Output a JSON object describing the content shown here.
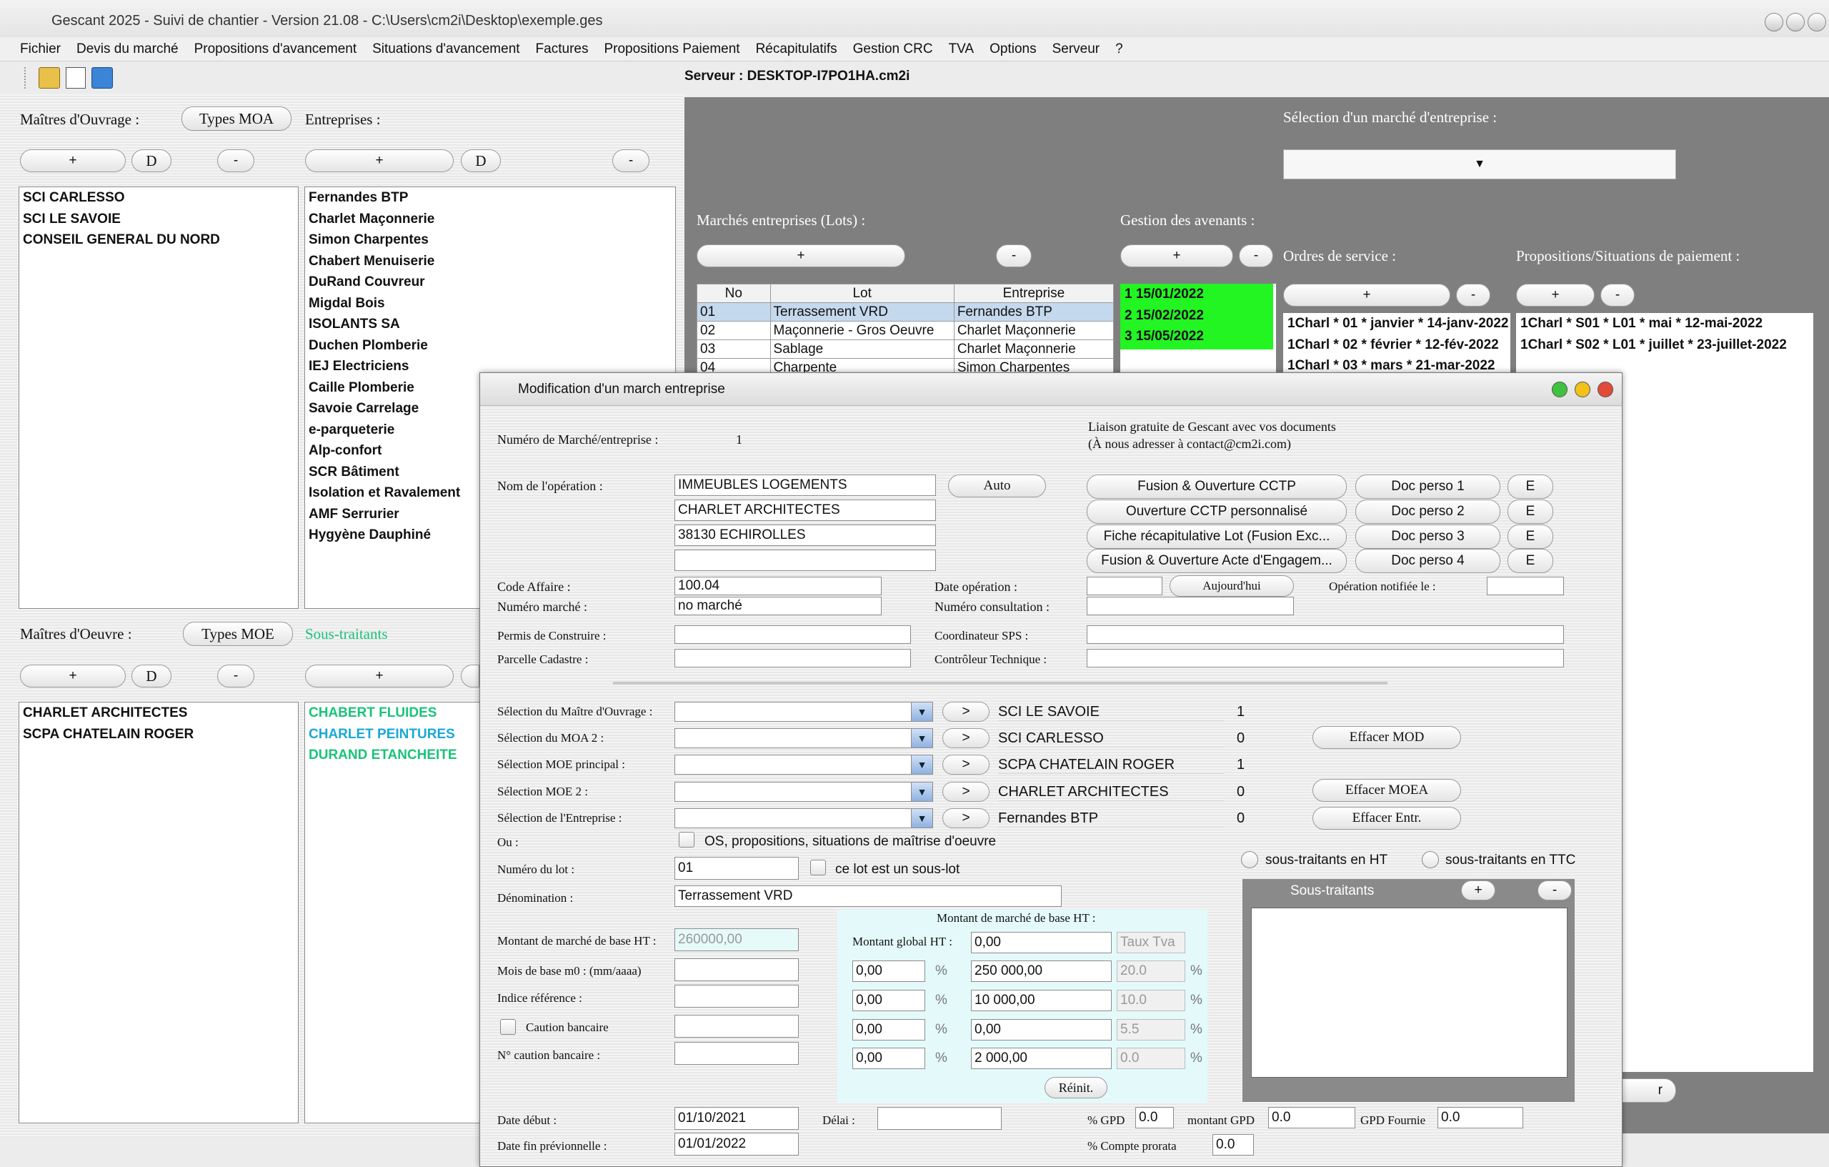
{
  "window": {
    "title": "Gescant 2025 - Suivi de chantier - Version 21.08 - C:\\Users\\cm2i\\Desktop\\exemple.ges"
  },
  "menu": [
    "Fichier",
    "Devis du marché",
    "Propositions d'avancement",
    "Situations d'avancement",
    "Factures",
    "Propositions Paiement",
    "Récapitulatifs",
    "Gestion CRC",
    "TVA",
    "Options",
    "Serveur",
    "?"
  ],
  "server": "Serveur : DESKTOP-I7PO1HA.cm2i",
  "left": {
    "moa_label": "Maîtres d'Ouvrage :",
    "types_moa": "Types MOA",
    "entreprises_label": "Entreprises :",
    "plus": "+",
    "d": "D",
    "minus": "-",
    "moa_list": [
      "SCI CARLESSO",
      "SCI LE SAVOIE",
      "CONSEIL GENERAL DU NORD"
    ],
    "entreprises": [
      "Fernandes BTP",
      "Charlet Maçonnerie",
      "Simon Charpentes",
      "Chabert Menuiserie",
      "DuRand Couvreur",
      "Migdal Bois",
      "ISOLANTS SA",
      "Duchen Plomberie",
      "IEJ Electriciens",
      "Caille Plomberie",
      "Savoie Carrelage",
      "e-parqueterie",
      "Alp-confort",
      "SCR Bâtiment",
      "Isolation et Ravalement",
      "AMF Serrurier",
      "Hygyène Dauphiné"
    ],
    "moe_label": "Maîtres d'Oeuvre :",
    "types_moe": "Types MOE",
    "sous_traitants_label": "Sous-traitants",
    "moe_list": [
      "CHARLET ARCHITECTES",
      "SCPA CHATELAIN ROGER"
    ],
    "sous_traitants": [
      {
        "name": "CHABERT FLUIDES",
        "color": "#19c37a"
      },
      {
        "name": "CHARLET PEINTURES",
        "color": "#19a8d8"
      },
      {
        "name": "DURAND ETANCHEITE",
        "color": "#19c37a"
      }
    ]
  },
  "right": {
    "selection_label": "Sélection d'un marché d'entreprise :",
    "marches_label": "Marchés entreprises (Lots) :",
    "avenants_label": "Gestion des avenants :",
    "ordres_label": "Ordres de service :",
    "propositions_label": "Propositions/Situations de paiement :",
    "lots_headers": [
      "No",
      "Lot",
      "Entreprise"
    ],
    "lots": [
      [
        "01",
        "Terrassement VRD",
        "Fernandes BTP"
      ],
      [
        "02",
        "Maçonnerie - Gros Oeuvre",
        "Charlet Maçonnerie"
      ],
      [
        "03",
        "Sablage",
        "Charlet Maçonnerie"
      ],
      [
        "04",
        "Charpente",
        "Simon Charpentes"
      ]
    ],
    "avenants": [
      "1 15/01/2022",
      "2 15/02/2022",
      "3 15/05/2022"
    ],
    "ordres": [
      "1Charl * 01 * janvier * 14-janv-2022",
      "1Charl * 02 * février * 12-fév-2022",
      "1Charl * 03 * mars * 21-mar-2022"
    ],
    "propositions": [
      "1Charl * S01 * L01 * mai * 12-mai-2022",
      "1Charl * S02 * L01 * juillet * 23-juillet-2022"
    ],
    "bottom_button_tail": "r"
  },
  "dialog": {
    "title": "Modification d'un march  entreprise",
    "numero_label": "Numéro de Marché/entreprise :",
    "numero": "1",
    "liaison_1": "Liaison gratuite de Gescant avec vos documents",
    "liaison_2": "(À nous adresser à contact@cm2i.com)",
    "nom_label": "Nom de l'opération :",
    "nom_lines": [
      "IMMEUBLES LOGEMENTS",
      "CHARLET ARCHITECTES",
      "38130 ECHIROLLES",
      ""
    ],
    "auto": "Auto",
    "doc_buttons": [
      "Fusion & Ouverture CCTP",
      "Ouverture CCTP personnalisé",
      "Fiche récapitulative Lot (Fusion Exc...",
      "Fusion & Ouverture Acte d'Engagem..."
    ],
    "perso_buttons": [
      "Doc perso 1",
      "Doc perso 2",
      "Doc perso 3",
      "Doc perso 4"
    ],
    "e": "E",
    "code_affaire_label": "Code Affaire  :",
    "code_affaire": "100.04",
    "numero_marche_label": "Numéro marché :",
    "numero_marche": "no marché",
    "date_op_label": "Date opération :",
    "aujourdhui": "Aujourd'hui",
    "op_notifiee_label": "Opération notifiée le :",
    "num_consult_label": "Numéro consultation :",
    "permis_label": "Permis de Construire :",
    "parcelle_label": "Parcelle Cadastre :",
    "coordinateur_label": "Coordinateur SPS :",
    "controleur_label": "Contrôleur Technique :",
    "selections": [
      {
        "label": "Sélection du Maître d'Ouvrage :",
        "value": "SCI LE SAVOIE",
        "n": "1"
      },
      {
        "label": "Sélection du MOA 2 :",
        "value": "SCI CARLESSO",
        "n": "0"
      },
      {
        "label": "Sélection MOE principal :",
        "value": "SCPA CHATELAIN ROGER",
        "n": "1"
      },
      {
        "label": "Sélection MOE 2 :",
        "value": "CHARLET ARCHITECTES",
        "n": "0"
      },
      {
        "label": "Sélection de l'Entreprise :",
        "value": "Fernandes BTP",
        "n": "0"
      }
    ],
    "go": ">",
    "effacer_mod": "Effacer MOD",
    "effacer_moea": "Effacer MOEA",
    "effacer_entr": "Effacer Entr.",
    "ou_label": "Ou :",
    "os_label": "OS, propositions, situations de maîtrise d'oeuvre",
    "num_lot_label": "Numéro du lot :",
    "num_lot": "01",
    "sous_lot_label": "ce lot est un sous-lot",
    "st_ht": "sous-traitants en HT",
    "st_ttc": "sous-traitants en TTC",
    "denomination_label": "Dénomination :",
    "denomination": "Terrassement VRD",
    "sous_traitants_title": "Sous-traitants",
    "montant_base_title": "Montant de marché de base HT :",
    "montant_base_label": "Montant de marché de base HT :",
    "montant_base": "260000,00",
    "mois_label": "Mois de base m0 : (mm/aaaa)",
    "indice_label": "Indice référence :",
    "caution_label": "Caution bancaire",
    "num_caution_label": "N° caution bancaire :",
    "montant_global_label": "Montant global HT :",
    "montant_global": "0,00",
    "taux_tva": "Taux Tva",
    "pct_rows": [
      {
        "p": "0,00",
        "amount": "250 000,00",
        "tva": "20.0"
      },
      {
        "p": "0,00",
        "amount": "10 000,00",
        "tva": "10.0"
      },
      {
        "p": "0,00",
        "amount": "0,00",
        "tva": "5.5"
      },
      {
        "p": "0,00",
        "amount": "2 000,00",
        "tva": "0.0"
      }
    ],
    "pct": "%",
    "reinit": "Réinit.",
    "date_debut_label": "Date début :",
    "date_debut": "01/10/2021",
    "delai_label": "Délai :",
    "gpd_label": "% GPD",
    "gpd": "0.0",
    "montant_gpd_label": "montant GPD",
    "montant_gpd": "0.0",
    "gpd_fournie_label": "GPD Fournie",
    "gpd_fournie": "0.0",
    "date_fin_label": "Date fin prévionnelle :",
    "date_fin": "01/01/2022",
    "compte_prorata_label": "% Compte prorata",
    "compte_prorata": "0.0"
  }
}
